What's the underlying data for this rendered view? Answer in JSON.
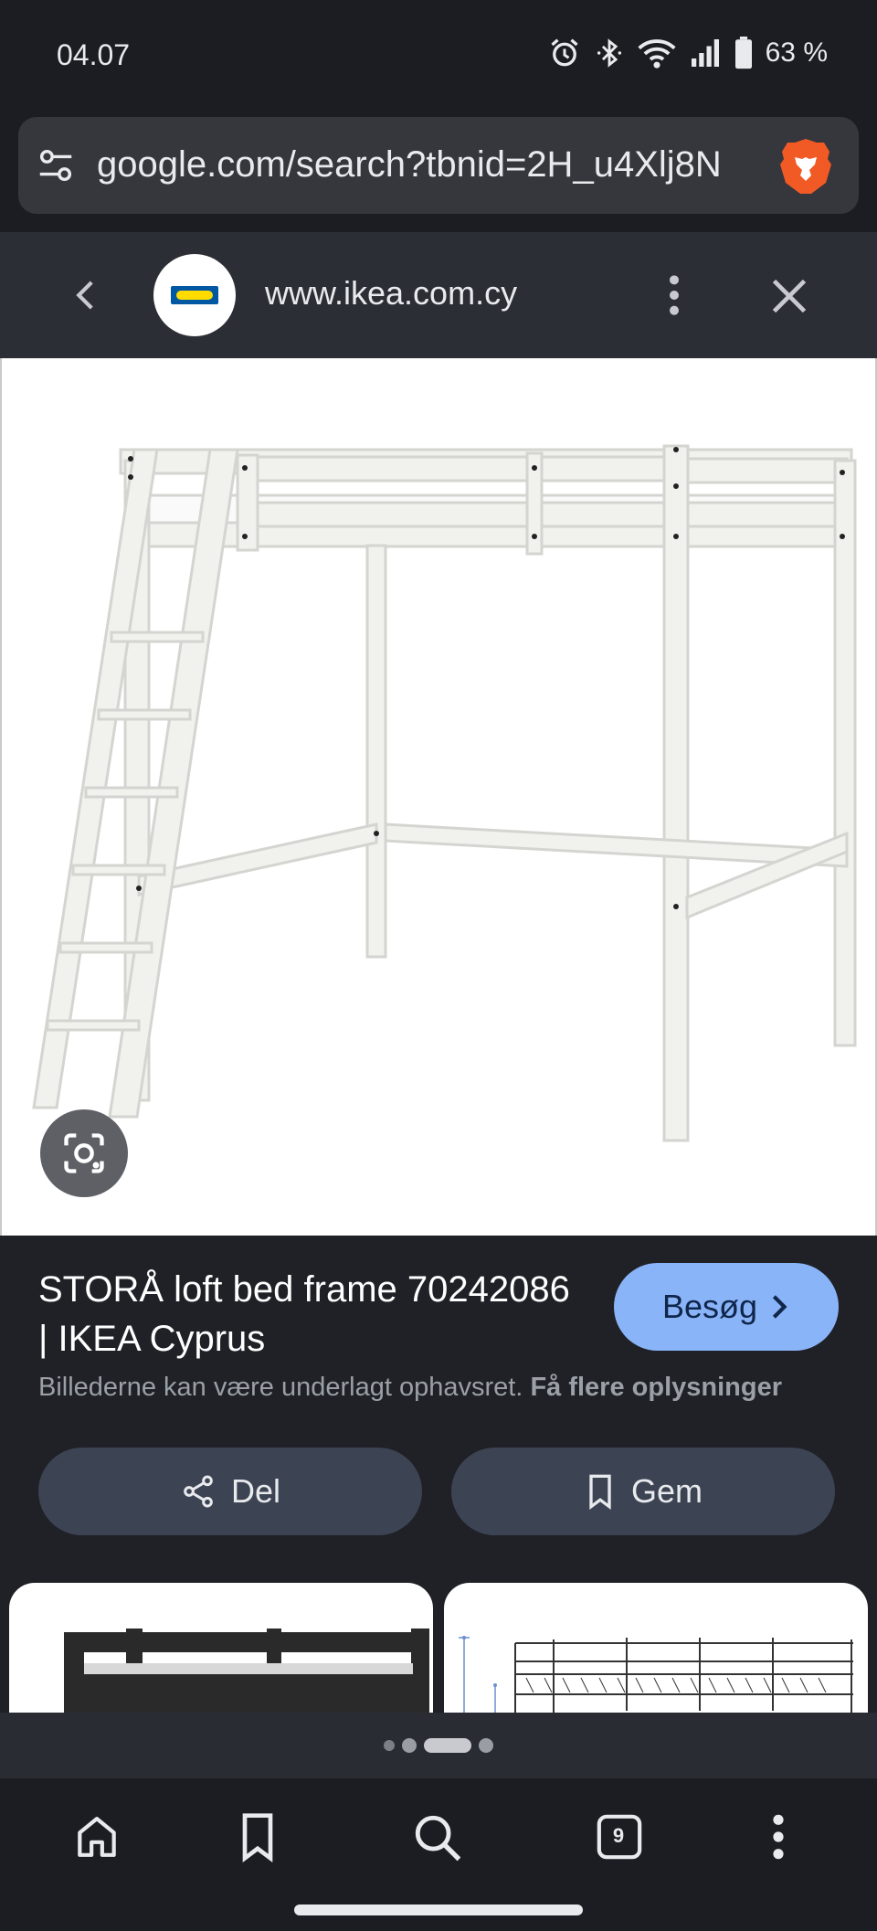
{
  "status_bar": {
    "time": "04.07",
    "battery": "63 %",
    "icons": [
      "alarm-icon",
      "bluetooth-icon",
      "wifi-icon",
      "signal-icon",
      "battery-icon"
    ]
  },
  "address_bar": {
    "url": "google.com/search?tbnid=2H_u4Xlj8N",
    "icons": [
      "tune-icon",
      "brave-shield-icon"
    ]
  },
  "source_header": {
    "domain": "www.ikea.com.cy",
    "icons": [
      "back-icon",
      "ikea-logo",
      "more-vert-icon",
      "close-icon"
    ]
  },
  "image": {
    "description_icon": "lens-icon"
  },
  "result": {
    "title": "STORÅ loft bed frame 70242086 | IKEA Cyprus",
    "visit_label": "Besøg",
    "copyright_text": "Billederne kan være underlagt ophavsret.",
    "copyright_link": "Få flere oplysninger",
    "share_label": "Del",
    "save_label": "Gem"
  },
  "pager": {
    "count": 4,
    "active_index": 2
  },
  "bottom_nav": {
    "tab_count": "9",
    "icons": [
      "home-icon",
      "bookmark-icon",
      "search-icon",
      "tabs-icon",
      "menu-icon"
    ]
  },
  "colors": {
    "background": "#1f2127",
    "accent": "#8ab4f8",
    "pill": "#3c4353",
    "ikea_blue": "#0058a3",
    "ikea_yellow": "#ffdb00",
    "brave_orange": "#f15a24"
  }
}
